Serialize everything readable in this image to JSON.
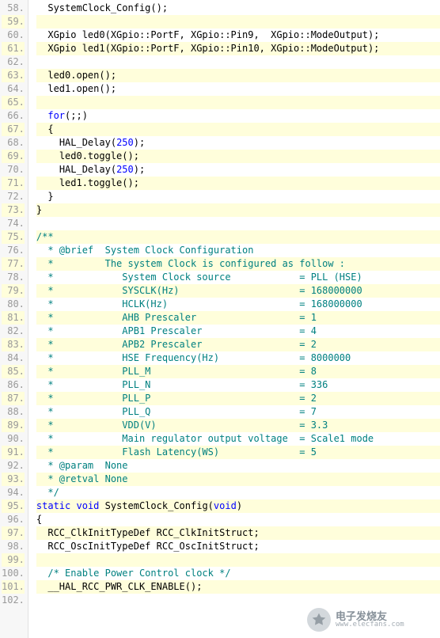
{
  "lines": [
    {
      "n": "58.",
      "ind": 2,
      "seg": [
        [
          "pl",
          "SystemClock_Config();"
        ]
      ]
    },
    {
      "n": "59.",
      "ind": 0,
      "seg": []
    },
    {
      "n": "60.",
      "ind": 2,
      "seg": [
        [
          "pl",
          "XGpio led0(XGpio::PortF, XGpio::Pin9,  XGpio::ModeOutput);"
        ]
      ]
    },
    {
      "n": "61.",
      "ind": 2,
      "seg": [
        [
          "pl",
          "XGpio led1(XGpio::PortF, XGpio::Pin10, XGpio::ModeOutput);"
        ]
      ]
    },
    {
      "n": "62.",
      "ind": 0,
      "seg": []
    },
    {
      "n": "63.",
      "ind": 2,
      "seg": [
        [
          "pl",
          "led0.open();"
        ]
      ]
    },
    {
      "n": "64.",
      "ind": 2,
      "seg": [
        [
          "pl",
          "led1.open();"
        ]
      ]
    },
    {
      "n": "65.",
      "ind": 0,
      "seg": []
    },
    {
      "n": "66.",
      "ind": 2,
      "seg": [
        [
          "kw",
          "for"
        ],
        [
          "pl",
          "(;;)"
        ]
      ]
    },
    {
      "n": "67.",
      "ind": 2,
      "seg": [
        [
          "pl",
          "{"
        ]
      ]
    },
    {
      "n": "68.",
      "ind": 4,
      "seg": [
        [
          "pl",
          "HAL_Delay("
        ],
        [
          "kw",
          "250"
        ],
        [
          "pl",
          ");"
        ]
      ]
    },
    {
      "n": "69.",
      "ind": 4,
      "seg": [
        [
          "pl",
          "led0.toggle();"
        ]
      ]
    },
    {
      "n": "70.",
      "ind": 4,
      "seg": [
        [
          "pl",
          "HAL_Delay("
        ],
        [
          "kw",
          "250"
        ],
        [
          "pl",
          ");"
        ]
      ]
    },
    {
      "n": "71.",
      "ind": 4,
      "seg": [
        [
          "pl",
          "led1.toggle();"
        ]
      ]
    },
    {
      "n": "72.",
      "ind": 2,
      "seg": [
        [
          "pl",
          "}"
        ]
      ]
    },
    {
      "n": "73.",
      "ind": 0,
      "seg": [
        [
          "pl",
          "}"
        ]
      ]
    },
    {
      "n": "74.",
      "ind": 0,
      "seg": []
    },
    {
      "n": "75.",
      "ind": 0,
      "seg": [
        [
          "cm",
          "/**"
        ]
      ]
    },
    {
      "n": "76.",
      "ind": 0,
      "seg": [
        [
          "cm",
          "  * @brief  System Clock Configuration"
        ]
      ]
    },
    {
      "n": "77.",
      "ind": 0,
      "seg": [
        [
          "cm",
          "  *         The system Clock is configured as follow :"
        ]
      ]
    },
    {
      "n": "78.",
      "ind": 0,
      "seg": [
        [
          "cm",
          "  *            System Clock source            = PLL (HSE)"
        ]
      ]
    },
    {
      "n": "79.",
      "ind": 0,
      "seg": [
        [
          "cm",
          "  *            SYSCLK(Hz)                     = 168000000"
        ]
      ]
    },
    {
      "n": "80.",
      "ind": 0,
      "seg": [
        [
          "cm",
          "  *            HCLK(Hz)                       = 168000000"
        ]
      ]
    },
    {
      "n": "81.",
      "ind": 0,
      "seg": [
        [
          "cm",
          "  *            AHB Prescaler                  = 1"
        ]
      ]
    },
    {
      "n": "82.",
      "ind": 0,
      "seg": [
        [
          "cm",
          "  *            APB1 Prescaler                 = 4"
        ]
      ]
    },
    {
      "n": "83.",
      "ind": 0,
      "seg": [
        [
          "cm",
          "  *            APB2 Prescaler                 = 2"
        ]
      ]
    },
    {
      "n": "84.",
      "ind": 0,
      "seg": [
        [
          "cm",
          "  *            HSE Frequency(Hz)              = 8000000"
        ]
      ]
    },
    {
      "n": "85.",
      "ind": 0,
      "seg": [
        [
          "cm",
          "  *            PLL_M                          = 8"
        ]
      ]
    },
    {
      "n": "86.",
      "ind": 0,
      "seg": [
        [
          "cm",
          "  *            PLL_N                          = 336"
        ]
      ]
    },
    {
      "n": "87.",
      "ind": 0,
      "seg": [
        [
          "cm",
          "  *            PLL_P                          = 2"
        ]
      ]
    },
    {
      "n": "88.",
      "ind": 0,
      "seg": [
        [
          "cm",
          "  *            PLL_Q                          = 7"
        ]
      ]
    },
    {
      "n": "89.",
      "ind": 0,
      "seg": [
        [
          "cm",
          "  *            VDD(V)                         = 3.3"
        ]
      ]
    },
    {
      "n": "90.",
      "ind": 0,
      "seg": [
        [
          "cm",
          "  *            Main regulator output voltage  = Scale1 mode"
        ]
      ]
    },
    {
      "n": "91.",
      "ind": 0,
      "seg": [
        [
          "cm",
          "  *            Flash Latency(WS)              = 5"
        ]
      ]
    },
    {
      "n": "92.",
      "ind": 0,
      "seg": [
        [
          "cm",
          "  * @param  None"
        ]
      ]
    },
    {
      "n": "93.",
      "ind": 0,
      "seg": [
        [
          "cm",
          "  * @retval None"
        ]
      ]
    },
    {
      "n": "94.",
      "ind": 0,
      "seg": [
        [
          "cm",
          "  */"
        ]
      ]
    },
    {
      "n": "95.",
      "ind": 0,
      "seg": [
        [
          "kw",
          "static"
        ],
        [
          "pl",
          " "
        ],
        [
          "kw",
          "void"
        ],
        [
          "pl",
          " SystemClock_Config("
        ],
        [
          "kw",
          "void"
        ],
        [
          "pl",
          ")"
        ]
      ]
    },
    {
      "n": "96.",
      "ind": 0,
      "seg": [
        [
          "pl",
          "{"
        ]
      ]
    },
    {
      "n": "97.",
      "ind": 2,
      "seg": [
        [
          "pl",
          "RCC_ClkInitTypeDef RCC_ClkInitStruct;"
        ]
      ]
    },
    {
      "n": "98.",
      "ind": 2,
      "seg": [
        [
          "pl",
          "RCC_OscInitTypeDef RCC_OscInitStruct;"
        ]
      ]
    },
    {
      "n": "99.",
      "ind": 0,
      "seg": []
    },
    {
      "n": "100.",
      "ind": 2,
      "seg": [
        [
          "cm",
          "/* Enable Power Control clock */"
        ]
      ]
    },
    {
      "n": "101.",
      "ind": 2,
      "seg": [
        [
          "pl",
          "__HAL_RCC_PWR_CLK_ENABLE();"
        ]
      ]
    },
    {
      "n": "102.",
      "ind": 0,
      "seg": []
    }
  ],
  "highlight_mod": 2,
  "watermark": {
    "cn": "电子发烧友",
    "url": "www.elecfans.com"
  }
}
